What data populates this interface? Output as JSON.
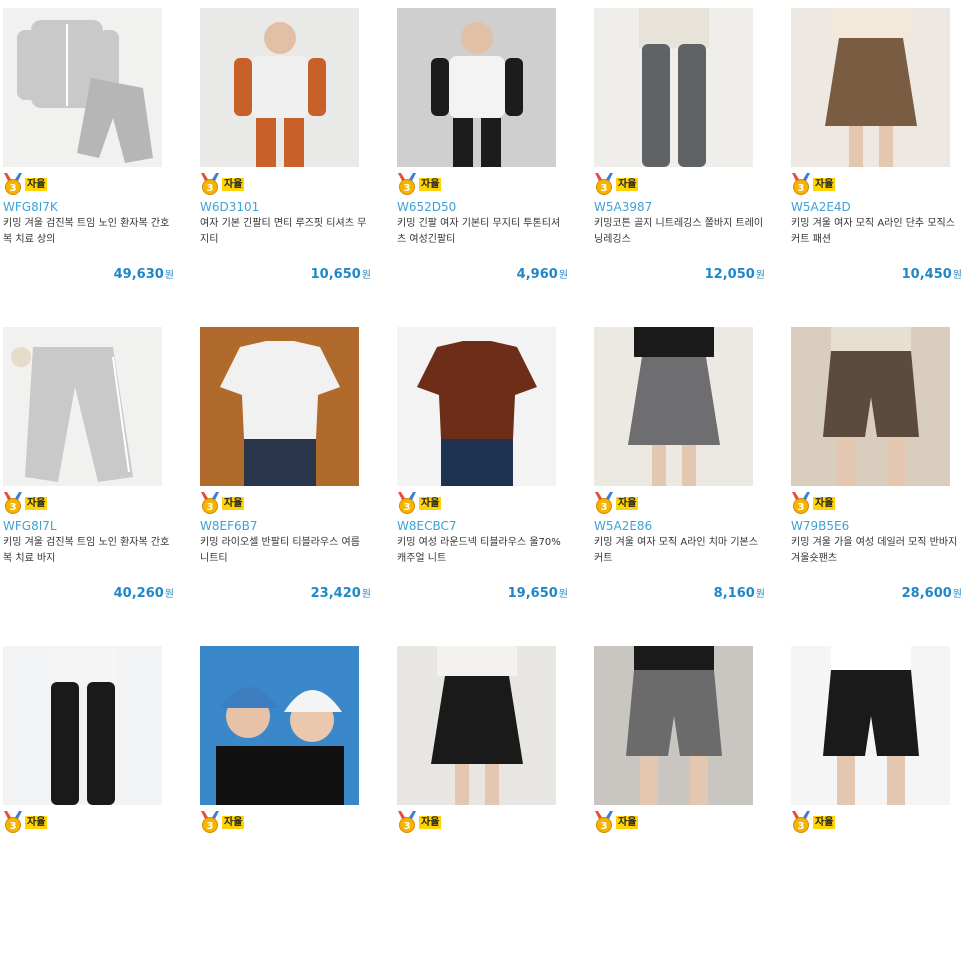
{
  "badge_label": "자율",
  "currency": "원",
  "products": [
    {
      "code": "WFG8I7K",
      "title": "키밍 겨울 검진복 트임 노인 환자복 간호복 치료 상의",
      "price": "49,630",
      "img": {
        "bg": "#f1f1ef",
        "c1": "#c9c9c9",
        "c2": "#b6b6b6",
        "kind": "set"
      }
    },
    {
      "code": "W6D3101",
      "title": "여자 기본 긴팔티 면티 루즈핏 티셔츠 무지티",
      "price": "10,650",
      "img": {
        "bg": "#e9e9e7",
        "c1": "#f0f0f0",
        "c2": "#c8602a",
        "kind": "model"
      }
    },
    {
      "code": "W652D50",
      "title": "키밍 긴팔 여자 기본티 무지티 투톤티셔츠 여성긴팔티",
      "price": "4,960",
      "img": {
        "bg": "#cfcfcf",
        "c1": "#f3f3f3",
        "c2": "#1c1c1c",
        "kind": "model"
      }
    },
    {
      "code": "W5A3987",
      "title": "키밍코튼 골지 니트레깅스 쫄바지 트레이닝레깅스",
      "price": "12,050",
      "img": {
        "bg": "#efeeea",
        "c1": "#5f6366",
        "c2": "#e8e3d8",
        "kind": "legs"
      }
    },
    {
      "code": "W5A2E4D",
      "title": "키밍 겨울 여자 모직 A라인 단추 모직스커트 패션",
      "price": "10,450",
      "img": {
        "bg": "#ede9e2",
        "c1": "#7a5c42",
        "c2": "#f3e9da",
        "kind": "skirt"
      }
    },
    {
      "code": "WFG8I7L",
      "title": "키밍 겨울 검진복 트임 노인 환자복 간호복 치료 바지",
      "price": "40,260",
      "img": {
        "bg": "#f1f1ef",
        "c1": "#c9c9c9",
        "c2": "#b6b6b6",
        "kind": "pants"
      }
    },
    {
      "code": "W8EF6B7",
      "title": "키밍 라이오셀 반팔티 티블라우스 여름 니트티",
      "price": "23,420",
      "img": {
        "bg": "#b06a2b",
        "c1": "#f1f1f1",
        "c2": "#29354b",
        "kind": "tee"
      }
    },
    {
      "code": "W8ECBC7",
      "title": "키밍 여성 라운드넥 티블라우스 울70% 캐주얼 니트",
      "price": "19,650",
      "img": {
        "bg": "#f3f3f3",
        "c1": "#6d2d19",
        "c2": "#1d3150",
        "kind": "tee"
      }
    },
    {
      "code": "W5A2E86",
      "title": "키밍 겨울 여자 모직 A라인 치마 기본스커트",
      "price": "8,160",
      "img": {
        "bg": "#ece8e2",
        "c1": "#6e6e70",
        "c2": "#1a1a1a",
        "kind": "skirt"
      }
    },
    {
      "code": "W79B5E6",
      "title": "키밍 겨울 가을 여성 데일러 모직 반바지 겨울숏팬츠",
      "price": "28,600",
      "img": {
        "bg": "#d9cdbd",
        "c1": "#5c4a3d",
        "c2": "#e7dfd0",
        "kind": "shorts"
      }
    },
    {
      "code": "",
      "title": "",
      "price": "",
      "img": {
        "bg": "#f2f3f4",
        "c1": "#1a1a1a",
        "c2": "#f5f5f5",
        "kind": "legs"
      }
    },
    {
      "code": "",
      "title": "",
      "price": "",
      "img": {
        "bg": "#3a87c9",
        "c1": "#3d7ec0",
        "c2": "#111111",
        "kind": "hat"
      }
    },
    {
      "code": "",
      "title": "",
      "price": "",
      "img": {
        "bg": "#e8e6e2",
        "c1": "#1a1a1a",
        "c2": "#f4f2ee",
        "kind": "skirt"
      }
    },
    {
      "code": "",
      "title": "",
      "price": "",
      "img": {
        "bg": "#c9c6c2",
        "c1": "#6b6b6b",
        "c2": "#1a1a1a",
        "kind": "shorts"
      }
    },
    {
      "code": "",
      "title": "",
      "price": "",
      "img": {
        "bg": "#f5f5f5",
        "c1": "#1a1a1a",
        "c2": "#ffffff",
        "kind": "shorts"
      }
    }
  ]
}
